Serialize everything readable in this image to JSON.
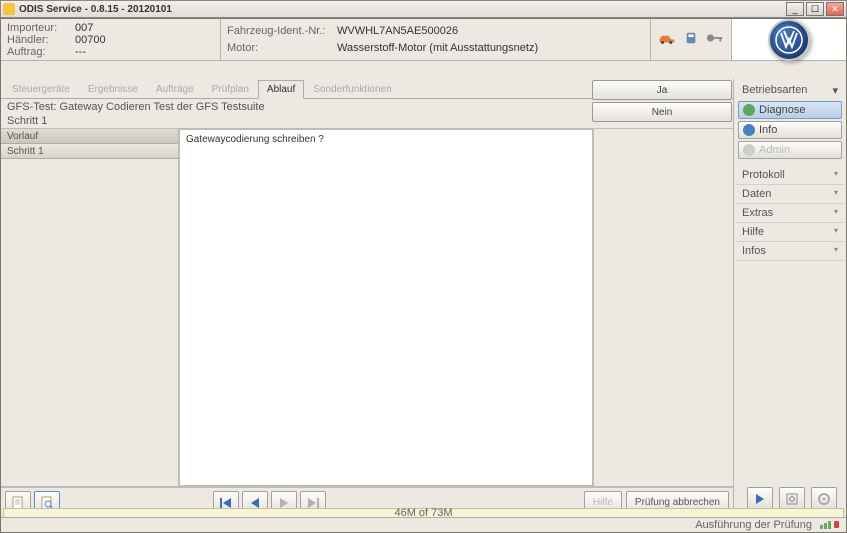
{
  "window": {
    "title": "ODIS Service - 0.8.15 - 20120101"
  },
  "header": {
    "col1": {
      "importer_label": "Importeur:",
      "importer_val": "007",
      "dealer_label": "Händler:",
      "dealer_val": "00700",
      "order_label": "Auftrag:",
      "order_val": "---"
    },
    "col2": {
      "vin_label": "Fahrzeug-Ident.-Nr.:",
      "vin_val": "WVWHL7AN5AE500026",
      "engine_label": "Motor:",
      "engine_val": "Wasserstoff-Motor (mit Ausstattungsnetz)"
    }
  },
  "tabs": [
    "Steuergeräte",
    "Ergebnisse",
    "Aufträge",
    "Prüfplan",
    "Ablauf",
    "Sonderfunktionen"
  ],
  "active_tab": 4,
  "testinfo": {
    "line1": "GFS-Test: Gateway Codieren Test der GFS Testsuite",
    "line2": "Schritt 1"
  },
  "yn": {
    "yes": "Ja",
    "no": "Nein"
  },
  "steps": {
    "header": "Vorlauf",
    "item1": "Schritt 1"
  },
  "message": "Gatewaycodierung schreiben ?",
  "bottom": {
    "help": "Hilfe",
    "cancel": "Prüfung abbrechen"
  },
  "sidebar": {
    "modes_title": "Betriebsarten",
    "diagnose": "Diagnose",
    "info": "Info",
    "admin": "Admin",
    "sections": [
      "Protokoll",
      "Daten",
      "Extras",
      "Hilfe",
      "Infos"
    ]
  },
  "status": {
    "right": "Ausführung der Prüfung"
  },
  "progress": {
    "text": "46M of 73M"
  }
}
